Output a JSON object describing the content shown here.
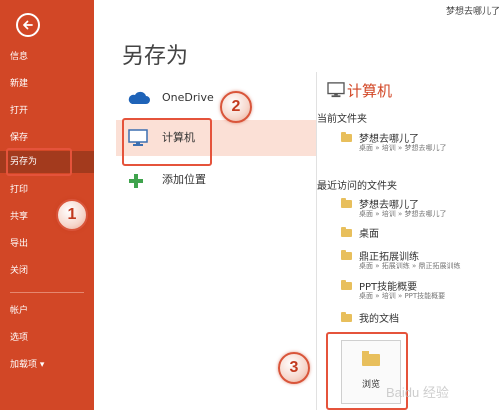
{
  "user": {
    "name": "梦想去哪儿了"
  },
  "sidebar": {
    "items": [
      {
        "label": "信息"
      },
      {
        "label": "新建"
      },
      {
        "label": "打开"
      },
      {
        "label": "保存"
      },
      {
        "label": "另存为",
        "active": true
      },
      {
        "label": "打印"
      },
      {
        "label": "共享"
      },
      {
        "label": "导出"
      },
      {
        "label": "关闭"
      },
      {
        "label": "帐户"
      },
      {
        "label": "选项"
      },
      {
        "label": "加载项 ▾"
      }
    ],
    "bg_color": "#d24726"
  },
  "main": {
    "title": "另存为",
    "locations": [
      {
        "label": "OneDrive",
        "icon": "cloud-icon"
      },
      {
        "label": "计算机",
        "icon": "computer-icon",
        "selected": true
      },
      {
        "label": "添加位置",
        "icon": "plus-icon"
      }
    ]
  },
  "right_panel": {
    "title": "计算机",
    "current_folder_title": "当前文件夹",
    "current_folder": {
      "name": "梦想去哪儿了",
      "path": "桌面 » 培训 » 梦想去哪儿了"
    },
    "recent_title": "最近访问的文件夹",
    "recent_folders": [
      {
        "name": "梦想去哪儿了",
        "path": "桌面 » 培训 » 梦想去哪儿了"
      },
      {
        "name": "桌面",
        "path": ""
      },
      {
        "name": "鼎正拓展训练",
        "path": "桌面 » 拓展训练 » 鼎正拓展训练"
      },
      {
        "name": "PPT技能概要",
        "path": "桌面 » 培训 » PPT技能概要"
      },
      {
        "name": "我的文档",
        "path": ""
      }
    ],
    "browse_label": "浏览"
  },
  "annotations": {
    "step1": "1",
    "step2": "2",
    "step3": "3"
  },
  "watermark": "Baidu 经验",
  "colors": {
    "accent": "#d24726",
    "highlight": "#e5533b",
    "selected_bg": "#fbe0d6"
  }
}
